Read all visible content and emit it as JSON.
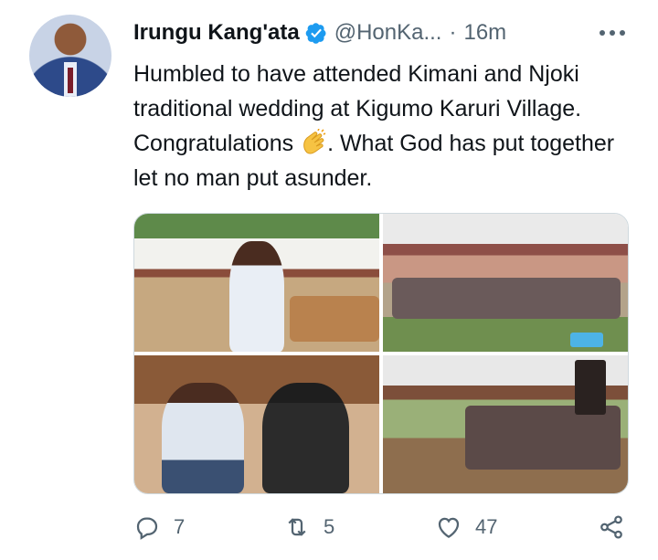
{
  "tweet": {
    "author_name": "Irungu Kang'ata",
    "handle": "@HonKa...",
    "separator": "·",
    "time": "16m",
    "text_before_emoji": "Humbled to have attended Kimani and Njoki traditional wedding at Kigumo Karuri Village.  Congratulations ",
    "emoji_icon": "clapping-hands-icon",
    "text_after_emoji": ". What God has put together let no man put asunder.",
    "media_count": 4
  },
  "actions": {
    "reply_count": "7",
    "retweet_count": "5",
    "like_count": "47"
  },
  "colors": {
    "text_primary": "#0f1419",
    "text_secondary": "#536471",
    "verified_blue": "#1d9bf0",
    "border": "#cfd9de"
  }
}
